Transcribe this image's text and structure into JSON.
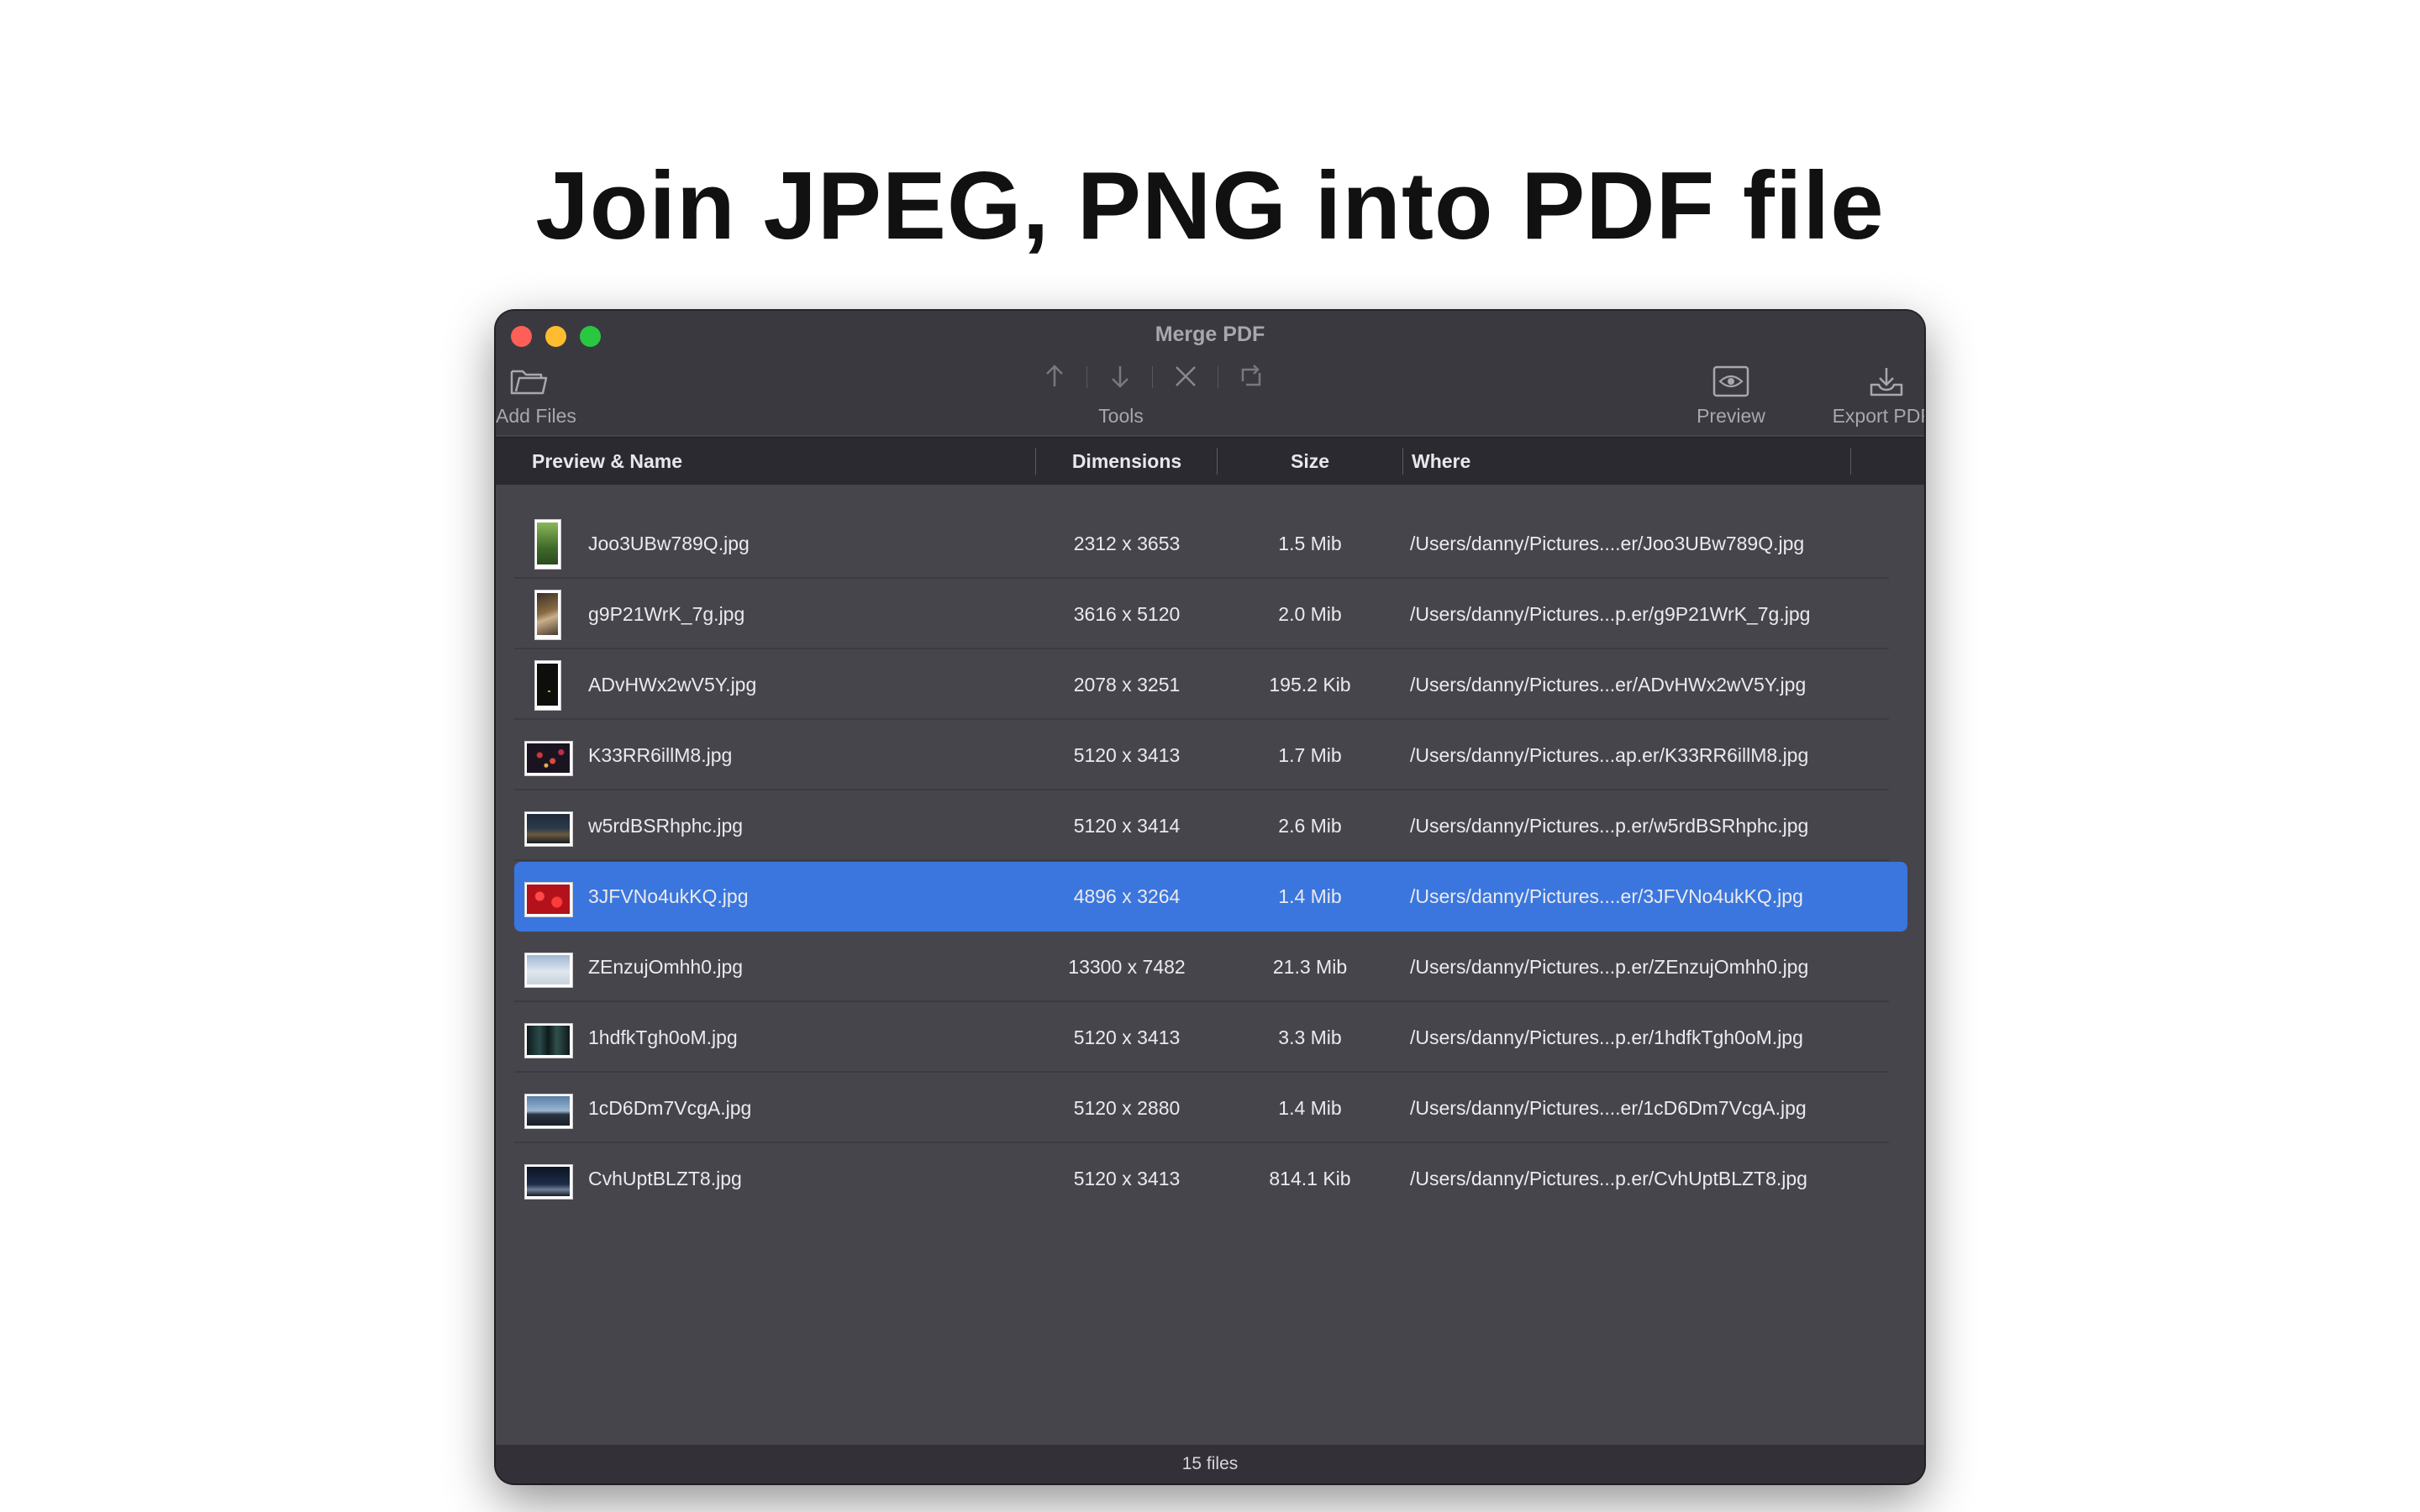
{
  "headline": "Join JPEG, PNG into PDF file",
  "window": {
    "title": "Merge PDF"
  },
  "toolbar": {
    "add_files_label": "Add Files",
    "tools_label": "Tools",
    "preview_label": "Preview",
    "export_label": "Export PDF"
  },
  "columns": {
    "name": "Preview & Name",
    "dimensions": "Dimensions",
    "size": "Size",
    "where": "Where"
  },
  "files": [
    {
      "name": "Joo3UBw789Q.jpg",
      "dimensions": "2312 x 3653",
      "size": "1.5 Mib",
      "where": "/Users/danny/Pictures....er/Joo3UBw789Q.jpg",
      "thumb": "portrait-green"
    },
    {
      "name": "g9P21WrK_7g.jpg",
      "dimensions": "3616 x 5120",
      "size": "2.0 Mib",
      "where": "/Users/danny/Pictures...p.er/g9P21WrK_7g.jpg",
      "thumb": "portrait-tiger"
    },
    {
      "name": "ADvHWx2wV5Y.jpg",
      "dimensions": "2078 x 3251",
      "size": "195.2 Kib",
      "where": "/Users/danny/Pictures...er/ADvHWx2wV5Y.jpg",
      "thumb": "portrait-dark"
    },
    {
      "name": "K33RR6illM8.jpg",
      "dimensions": "5120 x 3413",
      "size": "1.7 Mib",
      "where": "/Users/danny/Pictures...ap.er/K33RR6illM8.jpg",
      "thumb": "landscape-lights"
    },
    {
      "name": "w5rdBSRhphc.jpg",
      "dimensions": "5120 x 3414",
      "size": "2.6 Mib",
      "where": "/Users/danny/Pictures...p.er/w5rdBSRhphc.jpg",
      "thumb": "landscape-city"
    },
    {
      "name": "3JFVNo4ukKQ.jpg",
      "dimensions": "4896 x 3264",
      "size": "1.4 Mib",
      "where": "/Users/danny/Pictures....er/3JFVNo4ukKQ.jpg",
      "thumb": "landscape-red",
      "selected": true
    },
    {
      "name": "ZEnzujOmhh0.jpg",
      "dimensions": "13300 x 7482",
      "size": "21.3 Mib",
      "where": "/Users/danny/Pictures...p.er/ZEnzujOmhh0.jpg",
      "thumb": "landscape-light"
    },
    {
      "name": "1hdfkTgh0oM.jpg",
      "dimensions": "5120 x 3413",
      "size": "3.3 Mib",
      "where": "/Users/danny/Pictures...p.er/1hdfkTgh0oM.jpg",
      "thumb": "landscape-night"
    },
    {
      "name": "1cD6Dm7VcgA.jpg",
      "dimensions": "5120 x 2880",
      "size": "1.4 Mib",
      "where": "/Users/danny/Pictures....er/1cD6Dm7VcgA.jpg",
      "thumb": "landscape-mountain"
    },
    {
      "name": "CvhUptBLZT8.jpg",
      "dimensions": "5120 x 3413",
      "size": "814.1 Kib",
      "where": "/Users/danny/Pictures...p.er/CvhUptBLZT8.jpg",
      "thumb": "landscape-sky"
    }
  ],
  "footer": {
    "count": "15 files"
  },
  "colors": {
    "selection": "#3a76de",
    "window_bg": "#47454c",
    "close": "#fe5f57",
    "minimize": "#febc2e",
    "zoom": "#28c840"
  }
}
